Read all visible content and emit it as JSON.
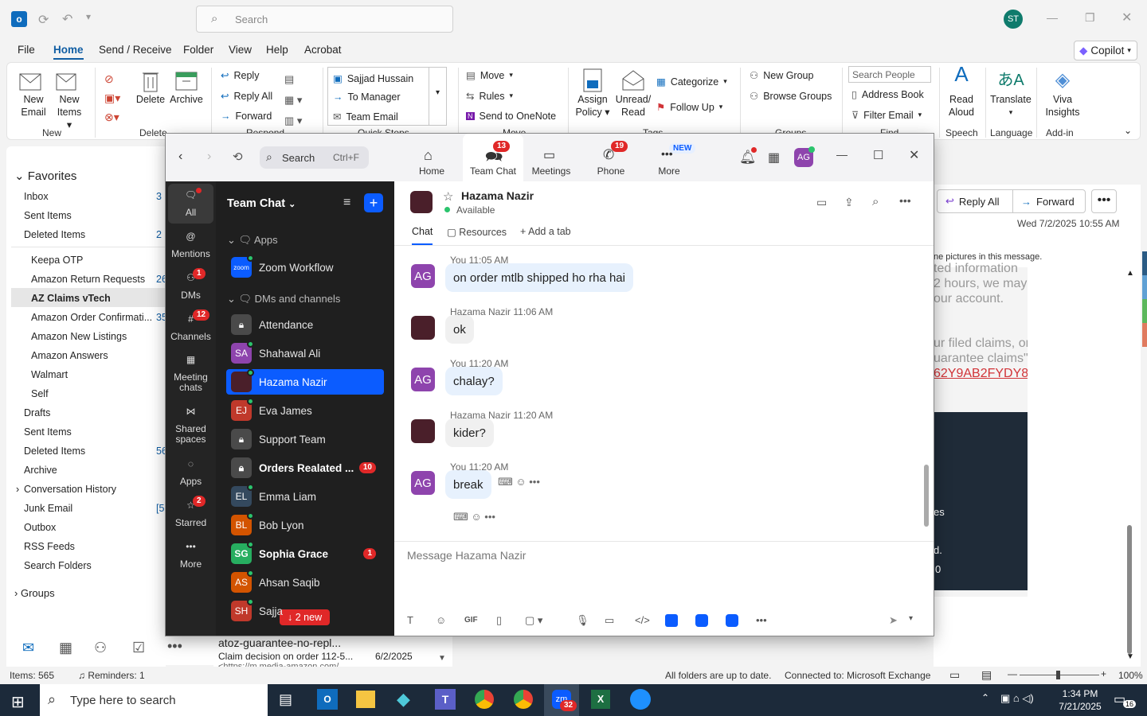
{
  "outlook": {
    "search_placeholder": "Search",
    "user_initials": "ST",
    "menu": [
      "File",
      "Home",
      "Send / Receive",
      "Folder",
      "View",
      "Help",
      "Acrobat"
    ],
    "copilot": "Copilot",
    "ribbon": {
      "new_email": [
        "New",
        "Email"
      ],
      "new_items": [
        "New",
        "Items"
      ],
      "delete": "Delete",
      "archive": "Archive",
      "reply": "Reply",
      "reply_all": "Reply All",
      "forward": "Forward",
      "quick_steps": [
        "Sajjad Hussain",
        "To Manager",
        "Team Email"
      ],
      "move": "Move",
      "rules": "Rules",
      "send_onenote": "Send to OneNote",
      "assign_policy": [
        "Assign",
        "Policy"
      ],
      "unread_read": [
        "Unread/",
        "Read"
      ],
      "categorize": "Categorize",
      "follow_up": "Follow Up",
      "new_group": "New Group",
      "browse_groups": "Browse Groups",
      "search_people": "Search People",
      "address_book": "Address Book",
      "filter_email": "Filter Email",
      "read_aloud": [
        "Read",
        "Aloud"
      ],
      "translate": "Translate",
      "viva": [
        "Viva",
        "Insights"
      ],
      "groups": {
        "new": "New",
        "delete": "Delete",
        "respond": "Respond",
        "quick": "Quick Steps",
        "move": "Move",
        "tags": "Tags",
        "groups": "Groups",
        "find": "Find",
        "speech": "Speech",
        "language": "Language",
        "addin": "Add-in"
      }
    },
    "folders": {
      "favorites": "Favorites",
      "items": [
        {
          "name": "Inbox",
          "count": "3"
        },
        {
          "name": "Sent Items",
          "count": ""
        },
        {
          "name": "Deleted Items",
          "count": "2"
        }
      ],
      "sub": [
        {
          "name": "Keepa OTP",
          "count": ""
        },
        {
          "name": "Amazon Return Requests",
          "count": "26"
        },
        {
          "name": "AZ Claims vTech",
          "count": ""
        },
        {
          "name": "Amazon Order Confirmati...",
          "count": "35"
        },
        {
          "name": "Amazon New Listings",
          "count": ""
        },
        {
          "name": "Amazon Answers",
          "count": ""
        },
        {
          "name": "Walmart",
          "count": ""
        },
        {
          "name": "Self",
          "count": ""
        }
      ],
      "more": [
        {
          "name": "Drafts",
          "count": ""
        },
        {
          "name": "Sent Items",
          "count": ""
        },
        {
          "name": "Deleted Items",
          "count": "56"
        },
        {
          "name": "Archive",
          "count": ""
        },
        {
          "name": "Conversation History",
          "count": ""
        },
        {
          "name": "Junk Email",
          "count": "[5"
        },
        {
          "name": "Outbox",
          "count": ""
        },
        {
          "name": "RSS Feeds",
          "count": ""
        },
        {
          "name": "Search Folders",
          "count": ""
        }
      ],
      "groups": "Groups"
    },
    "mail_item": {
      "from": "atoz-guarantee-no-repl...",
      "subject": "Claim decision on order 112-5...",
      "preview": "<https://m.media-amazon.com/...",
      "date": "6/2/2025"
    },
    "reading": {
      "reply_all": "Reply All",
      "forward": "Forward",
      "date": "Wed 7/2/2025 10:55 AM",
      "pictures_note": "ne pictures in this message.",
      "body": [
        "ted information",
        "2 hours, we may",
        "our account.",
        "ur filed claims, or",
        "uarantee claims\":",
        "62Y9AB2FYDY8"
      ],
      "dark_text": [
        "es",
        "d.",
        "0"
      ]
    },
    "status": {
      "items": "Items: 565",
      "reminders": "Reminders: 1",
      "sync": "All folders are up to date.",
      "connected": "Connected to: Microsoft Exchange",
      "zoom": "100%"
    }
  },
  "zoom": {
    "search": "Search",
    "shortcut": "Ctrl+F",
    "tabs": [
      {
        "label": "Home",
        "badge": ""
      },
      {
        "label": "Team Chat",
        "badge": "13"
      },
      {
        "label": "Meetings",
        "badge": ""
      },
      {
        "label": "Phone",
        "badge": "19"
      },
      {
        "label": "More",
        "badge": "NEW"
      }
    ],
    "user_initials": "AG",
    "rail": [
      {
        "label": "All",
        "badge": ""
      },
      {
        "label": "Mentions",
        "badge": ""
      },
      {
        "label": "DMs",
        "badge": "1"
      },
      {
        "label": "Channels",
        "badge": "12"
      },
      {
        "label": "Meeting chats",
        "badge": ""
      },
      {
        "label": "Shared spaces",
        "badge": ""
      },
      {
        "label": "Apps",
        "badge": ""
      },
      {
        "label": "Starred",
        "badge": "2"
      },
      {
        "label": "More",
        "badge": ""
      }
    ],
    "list_title": "Team Chat",
    "section_apps": "Apps",
    "zoom_workflow": "Zoom Workflow",
    "section_dms": "DMs and channels",
    "contacts": [
      {
        "name": "Attendance",
        "initials": "",
        "color": "#4a4a4a",
        "badge": ""
      },
      {
        "name": "Shahawal Ali",
        "initials": "SA",
        "color": "#8e44ad",
        "badge": ""
      },
      {
        "name": "Hazama Nazir",
        "initials": "",
        "color": "#4a1f2a",
        "badge": ""
      },
      {
        "name": "Eva James",
        "initials": "EJ",
        "color": "#c0392b",
        "badge": ""
      },
      {
        "name": "Support Team",
        "initials": "",
        "color": "#4a4a4a",
        "badge": ""
      },
      {
        "name": "Orders Realated ...",
        "initials": "",
        "color": "#4a4a4a",
        "badge": "10"
      },
      {
        "name": "Emma Liam",
        "initials": "EL",
        "color": "#34495e",
        "badge": ""
      },
      {
        "name": "Bob Lyon",
        "initials": "BL",
        "color": "#d35400",
        "badge": ""
      },
      {
        "name": "Sophia Grace",
        "initials": "SG",
        "color": "#27ae60",
        "badge": "1"
      },
      {
        "name": "Ahsan Saqib",
        "initials": "AS",
        "color": "#d35400",
        "badge": ""
      },
      {
        "name": "Sajja",
        "initials": "SH",
        "color": "#c0392b",
        "badge": ""
      }
    ],
    "new_pill": "2 new",
    "chat": {
      "name": "Hazama Nazir",
      "status": "Available",
      "tabs": [
        "Chat",
        "Resources",
        "Add a tab"
      ],
      "messages": [
        {
          "who": "You",
          "time": "11:05 AM",
          "text": "on order mtlb shipped ho rha hai",
          "me": true
        },
        {
          "who": "Hazama Nazir",
          "time": "11:06 AM",
          "text": "ok",
          "me": false
        },
        {
          "who": "You",
          "time": "11:20 AM",
          "text": "chalay?",
          "me": true
        },
        {
          "who": "Hazama Nazir",
          "time": "11:20 AM",
          "text": "kider?",
          "me": false
        },
        {
          "who": "You",
          "time": "11:20 AM",
          "text": "break",
          "me": true
        }
      ],
      "placeholder": "Message Hazama Nazir"
    }
  },
  "taskbar": {
    "search": "Type here to search",
    "time": "1:34 PM",
    "date": "7/21/2025",
    "notif": "16",
    "zoom_badge": "32"
  },
  "colors": {
    "accent": "#0f6cbd",
    "zoom_blue": "#0b5cff",
    "badge_red": "#e02828"
  }
}
